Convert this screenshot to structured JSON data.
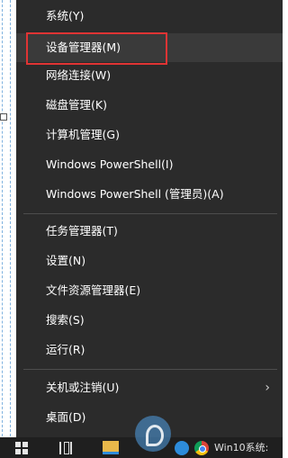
{
  "menu": {
    "items": [
      {
        "label": "系统(Y)"
      },
      {
        "label": "设备管理器(M)"
      },
      {
        "label": "网络连接(W)"
      },
      {
        "label": "磁盘管理(K)"
      },
      {
        "label": "计算机管理(G)"
      },
      {
        "label": "Windows PowerShell(I)"
      },
      {
        "label": "Windows PowerShell (管理员)(A)"
      },
      {
        "label": "任务管理器(T)"
      },
      {
        "label": "设置(N)"
      },
      {
        "label": "文件资源管理器(E)"
      },
      {
        "label": "搜索(S)"
      },
      {
        "label": "运行(R)"
      },
      {
        "label": "关机或注销(U)"
      },
      {
        "label": "桌面(D)"
      }
    ],
    "highlighted_item": "设备管理器(M)",
    "submenu_arrow": "›"
  },
  "taskbar": {
    "text": "Win10系统:",
    "icons": [
      "windows-start-icon",
      "task-view-icon",
      "file-explorer-icon",
      "edge-icon",
      "chrome-icon"
    ]
  },
  "colors": {
    "menu_bg": "#2b2b2b",
    "highlight_border": "#e03434",
    "taskbar_bg": "#1f1f1f"
  }
}
